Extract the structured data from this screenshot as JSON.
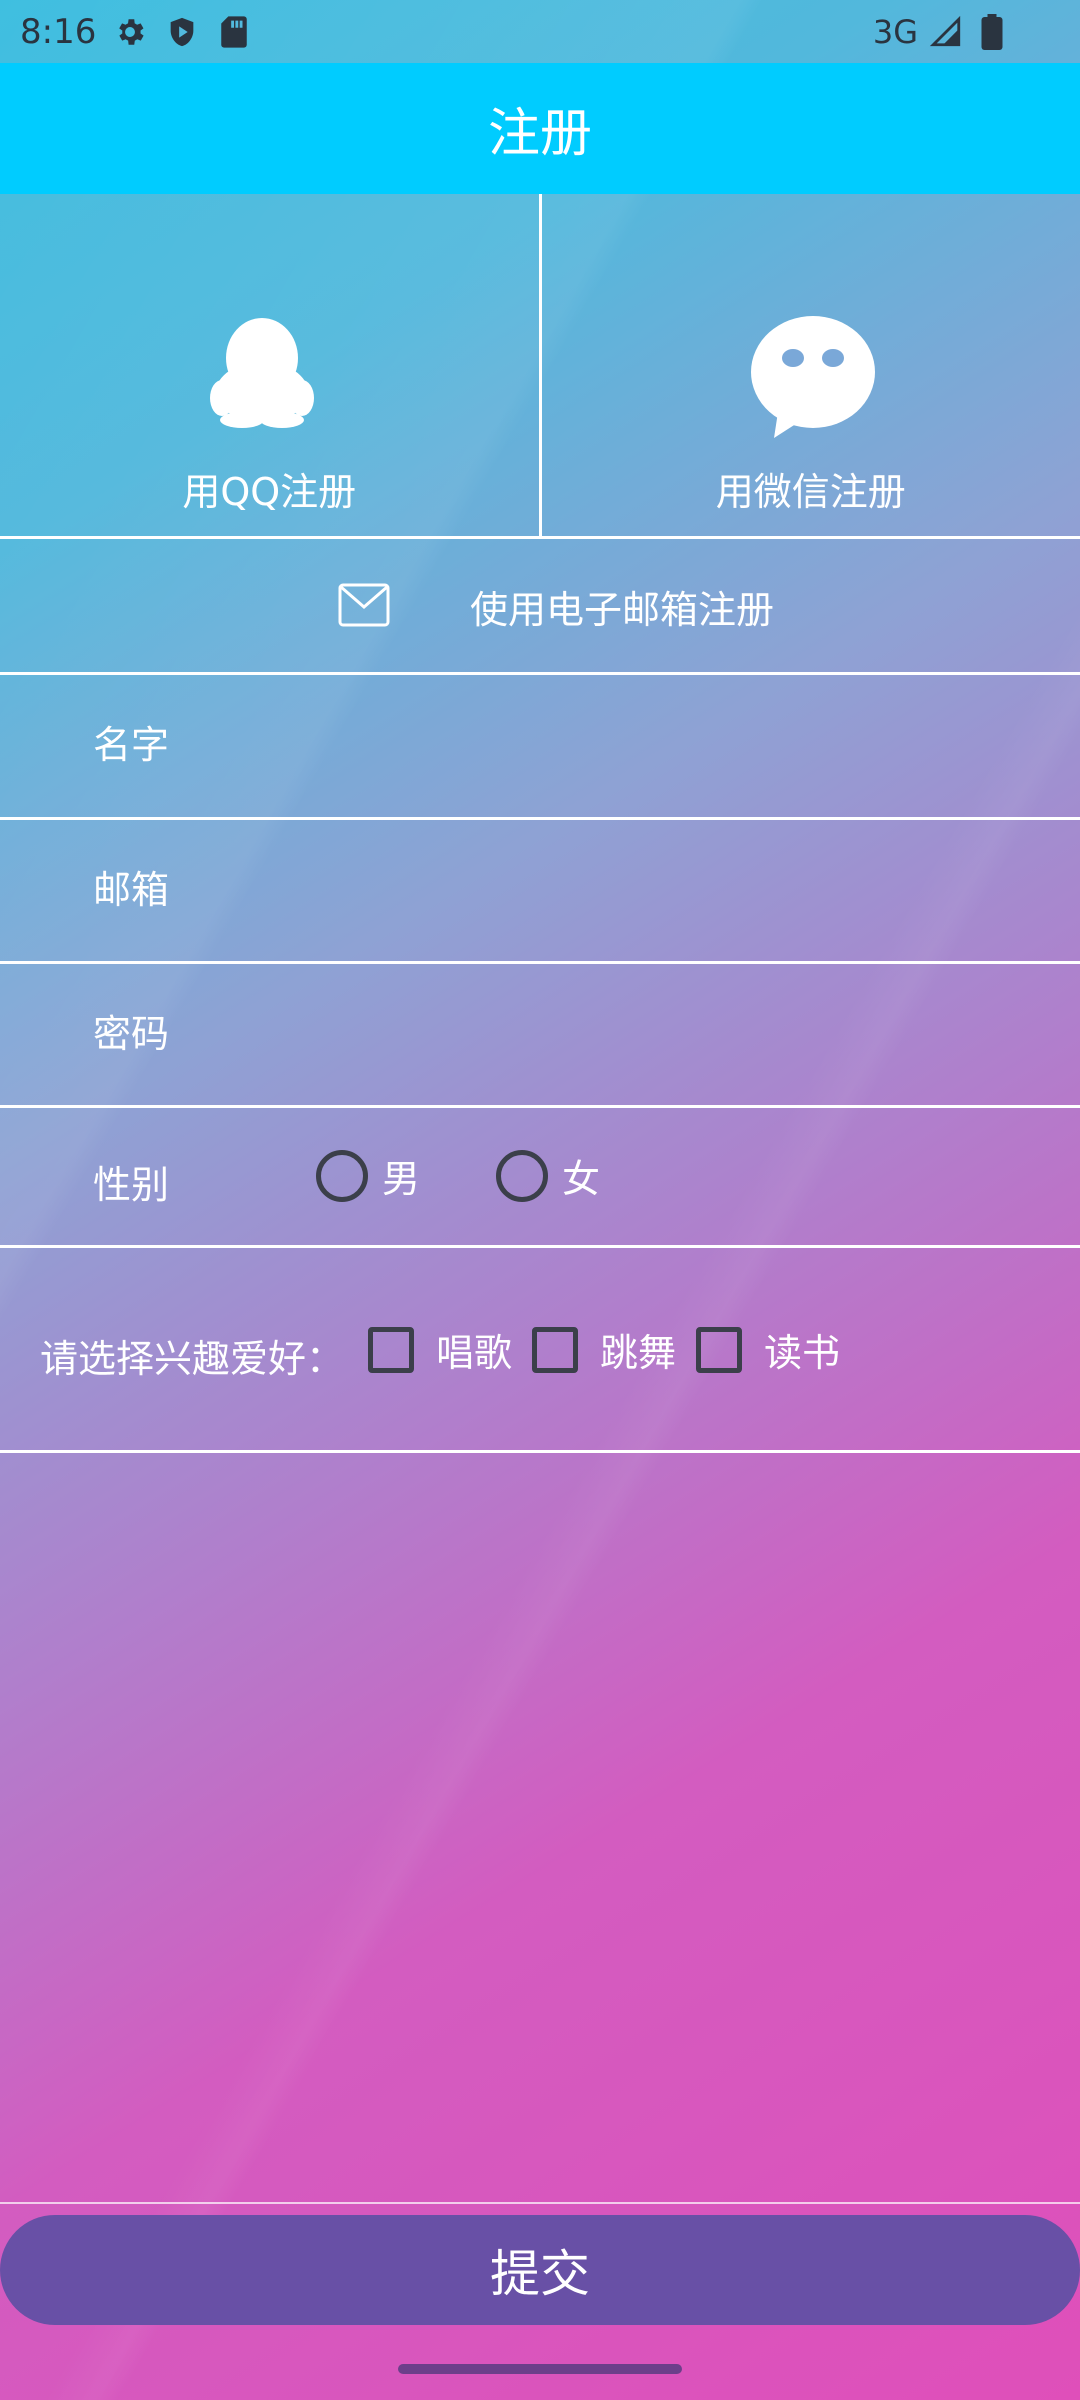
{
  "status_bar": {
    "time": "8:16",
    "network": "3G",
    "icons": [
      "gear-icon",
      "shield-play-icon",
      "sd-card-icon",
      "signal-icon",
      "battery-icon"
    ]
  },
  "app_bar": {
    "title": "注册"
  },
  "social": {
    "qq_label": "用QQ注册",
    "wechat_label": "用微信注册"
  },
  "email_option": {
    "label": "使用电子邮箱注册"
  },
  "form": {
    "name_placeholder": "名字",
    "email_placeholder": "邮箱",
    "password_placeholder": "密码",
    "gender": {
      "label": "性别",
      "options": [
        "男",
        "女"
      ]
    },
    "hobbies": {
      "label": "请选择兴趣爱好：",
      "options": [
        "唱歌",
        "跳舞",
        "读书"
      ]
    }
  },
  "submit": {
    "label": "提交"
  },
  "colors": {
    "app_bar": "#00ccff",
    "submit_button": "#6850a6",
    "gradient_start": "#3fbfe0",
    "gradient_end": "#df4fba"
  }
}
